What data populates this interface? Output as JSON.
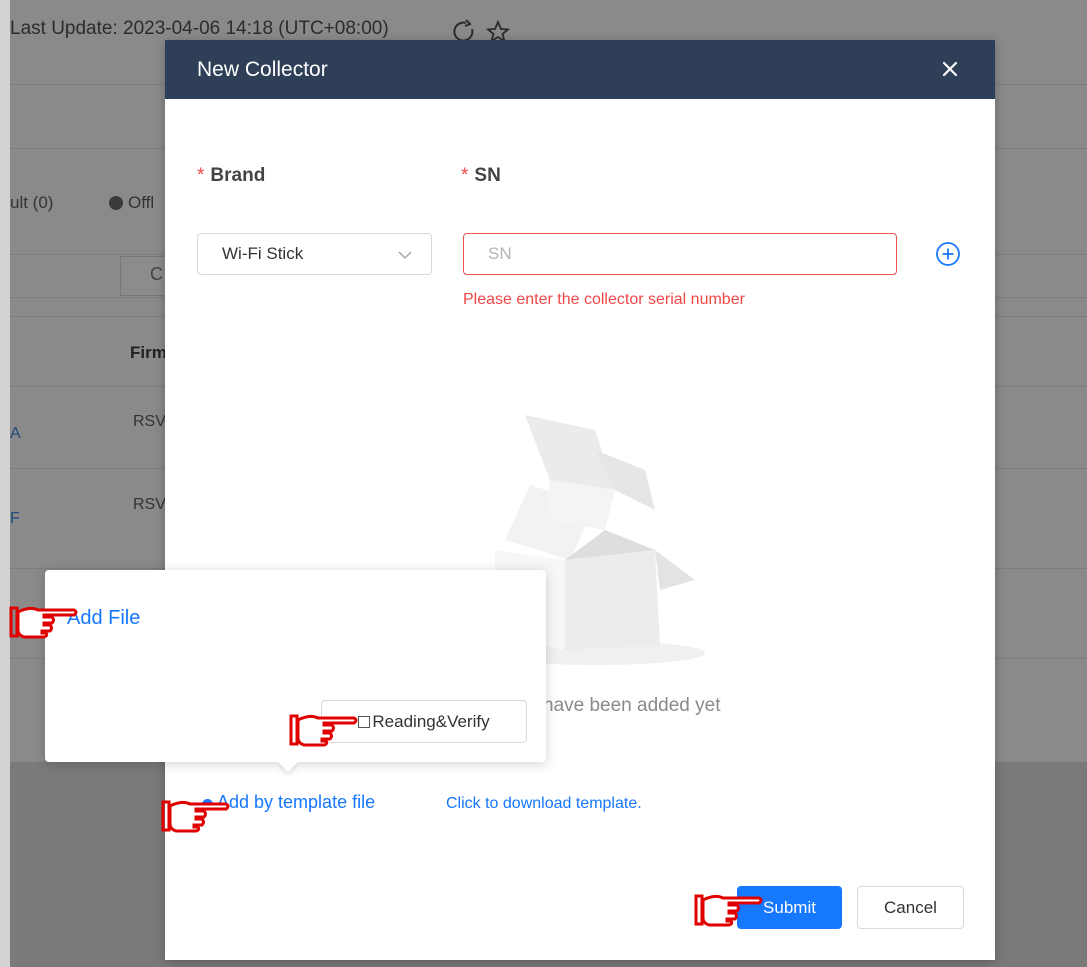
{
  "background": {
    "last_update": "Last Update: 2023-04-06 14:18 (UTC+08:00)",
    "fault_label": "ult (0)",
    "offline_label": "Offl",
    "tab_letter": "C",
    "firmware_header": "Firm",
    "row1_firmware": "RSV",
    "row2_firmware": "RSV",
    "row1_link": "A",
    "row2_link": "F"
  },
  "modal": {
    "title": "New Collector",
    "brand_label": "Brand",
    "sn_label": "SN",
    "required_mark": "*",
    "brand_value": "Wi-Fi Stick",
    "sn_placeholder": "SN",
    "sn_value": "",
    "sn_error": "Please enter the collector serial number",
    "empty_text": "have been added yet",
    "template_option": "Add by template file",
    "download_link": "Click to download template.",
    "submit_label": "Submit",
    "cancel_label": "Cancel"
  },
  "popover": {
    "add_file": "Add File",
    "verify_label": "Reading&Verify"
  },
  "colors": {
    "header_bg": "#2f3f58",
    "primary": "#1677ff",
    "error": "#f04747",
    "pointer_red": "#e00000"
  },
  "icons": [
    "refresh-icon",
    "star-icon",
    "close-icon",
    "chevron-down-icon",
    "plus-circle-icon",
    "empty-box-illustration",
    "hand-pointer-icon"
  ]
}
